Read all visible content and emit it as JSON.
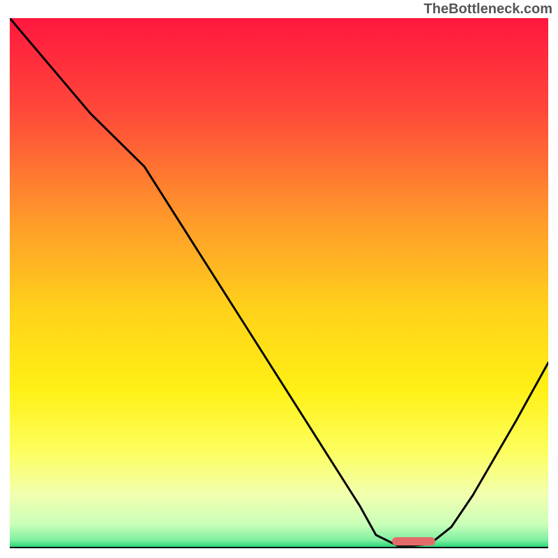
{
  "watermark": "TheBottleneck.com",
  "chart_data": {
    "type": "line",
    "title": "",
    "xlabel": "",
    "ylabel": "",
    "xlim": [
      0,
      100
    ],
    "ylim": [
      0,
      100
    ],
    "grid": false,
    "legend": false,
    "background_gradient": {
      "stops": [
        {
          "offset": 0.0,
          "color": "#ff173e"
        },
        {
          "offset": 0.18,
          "color": "#ff4a3a"
        },
        {
          "offset": 0.38,
          "color": "#ff9a2a"
        },
        {
          "offset": 0.55,
          "color": "#ffd21a"
        },
        {
          "offset": 0.7,
          "color": "#fff015"
        },
        {
          "offset": 0.82,
          "color": "#fdff60"
        },
        {
          "offset": 0.9,
          "color": "#f1ffb0"
        },
        {
          "offset": 0.955,
          "color": "#c9ffb8"
        },
        {
          "offset": 0.985,
          "color": "#7ef0a0"
        },
        {
          "offset": 1.0,
          "color": "#18d070"
        }
      ]
    },
    "series": [
      {
        "name": "bottleneck-curve",
        "x": [
          0,
          5,
          10,
          15,
          20,
          25,
          30,
          35,
          40,
          45,
          50,
          55,
          60,
          65,
          68,
          72,
          75,
          78,
          82,
          86,
          90,
          94,
          100
        ],
        "y": [
          100,
          94,
          88,
          82,
          77,
          72,
          64,
          56,
          48,
          40,
          32,
          24,
          16,
          8,
          2.5,
          0.5,
          0.5,
          0.8,
          4,
          10,
          17,
          24,
          35
        ]
      }
    ],
    "marker": {
      "name": "optimal-range",
      "x_start": 71,
      "x_end": 79,
      "y": 1.3,
      "color": "#e46a6a"
    }
  }
}
